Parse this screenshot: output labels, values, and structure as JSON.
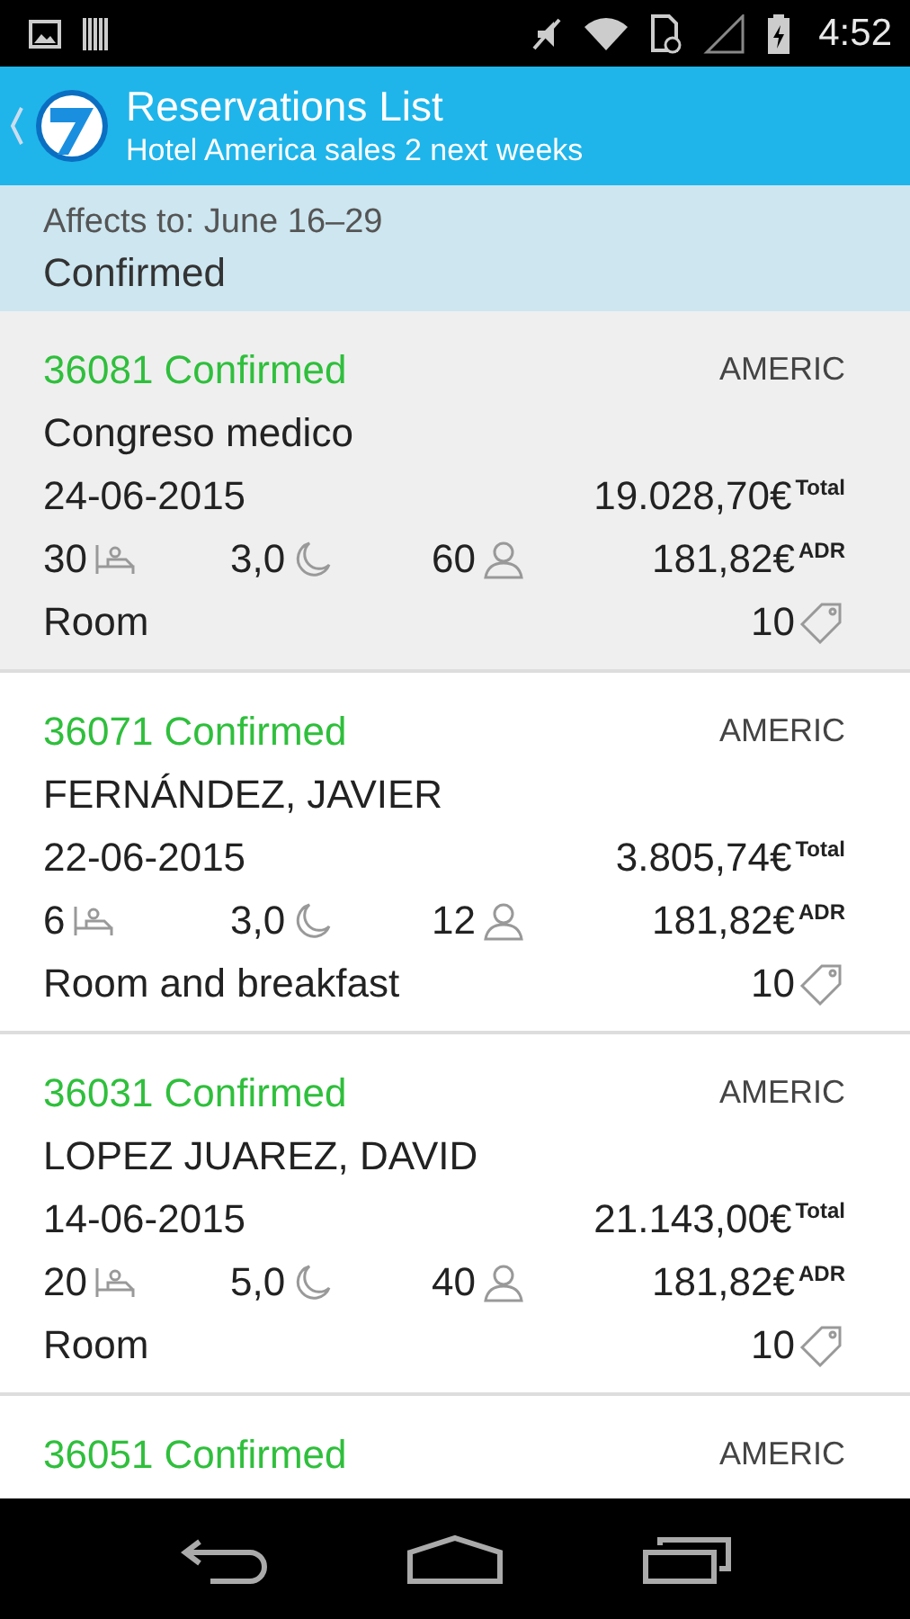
{
  "status_bar": {
    "time": "4:52"
  },
  "action_bar": {
    "title": "Reservations List",
    "subtitle": "Hotel America sales 2 next weeks"
  },
  "filter": {
    "affects": "Affects to: June 16–29",
    "status": "Confirmed"
  },
  "reservations": [
    {
      "title": "36081 Confirmed",
      "hotel": "AMERIC",
      "name": "Congreso medico",
      "date": "24-06-2015",
      "total": "19.028,70€",
      "total_label": "Total",
      "rooms": "30",
      "nights": "3,0",
      "guests": "60",
      "adr": "181,82€",
      "adr_label": "ADR",
      "board": "Room",
      "discount": "10",
      "selected": true
    },
    {
      "title": "36071 Confirmed",
      "hotel": "AMERIC",
      "name": "FERNÁNDEZ, JAVIER",
      "date": "22-06-2015",
      "total": "3.805,74€",
      "total_label": "Total",
      "rooms": "6",
      "nights": "3,0",
      "guests": "12",
      "adr": "181,82€",
      "adr_label": "ADR",
      "board": "Room and breakfast",
      "discount": "10",
      "selected": false
    },
    {
      "title": "36031 Confirmed",
      "hotel": "AMERIC",
      "name": "LOPEZ JUAREZ, DAVID",
      "date": "14-06-2015",
      "total": "21.143,00€",
      "total_label": "Total",
      "rooms": "20",
      "nights": "5,0",
      "guests": "40",
      "adr": "181,82€",
      "adr_label": "ADR",
      "board": "Room",
      "discount": "10",
      "selected": false
    },
    {
      "title": "36051 Confirmed",
      "hotel": "AMERIC",
      "selected": false
    }
  ]
}
